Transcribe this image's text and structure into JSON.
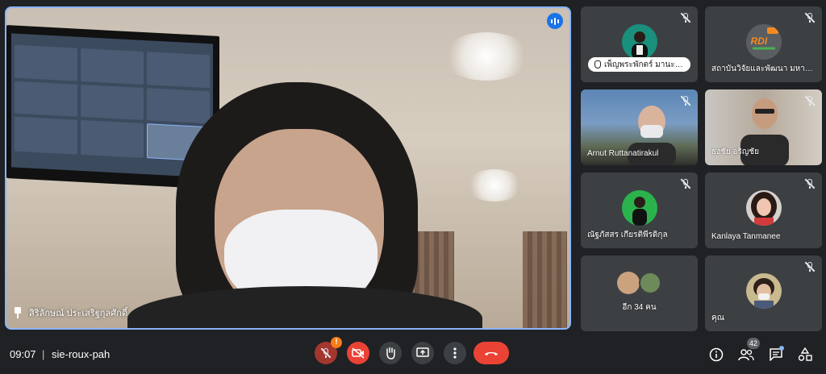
{
  "main_speaker": {
    "name": "สิริลักษณ์ ประเสริฐกุลศักดิ์"
  },
  "participants": [
    {
      "name": "เพ็ญพระพักตร์ มานะปริ...",
      "muted": true,
      "raised_hand": true
    },
    {
      "name": "สถาบันวิจัยและพัฒนา มหาร...",
      "muted": true,
      "logo_text": "RDI"
    },
    {
      "name": "Arnut Ruttanatirakul",
      "muted": true
    },
    {
      "name": "ธงชัย อริญชัย",
      "muted": true
    },
    {
      "name": "ณัฐภัสสร เกียรติพีรดิกุล",
      "muted": true
    },
    {
      "name": "Kanlaya Tanmanee",
      "muted": true
    },
    {
      "name": "อีก 34 คน",
      "muted": false
    },
    {
      "name": "คุณ",
      "muted": true
    }
  ],
  "bottom_bar": {
    "time": "09:07",
    "separator": "|",
    "meeting_code": "sie-roux-pah",
    "mic_warning": "!",
    "people_count": "42"
  },
  "colors": {
    "background": "#202124",
    "tile": "#3c4043",
    "active_border": "#8ab4f8",
    "danger": "#ea4335",
    "warning": "#fa7b17",
    "accent": "#1a73e8"
  }
}
